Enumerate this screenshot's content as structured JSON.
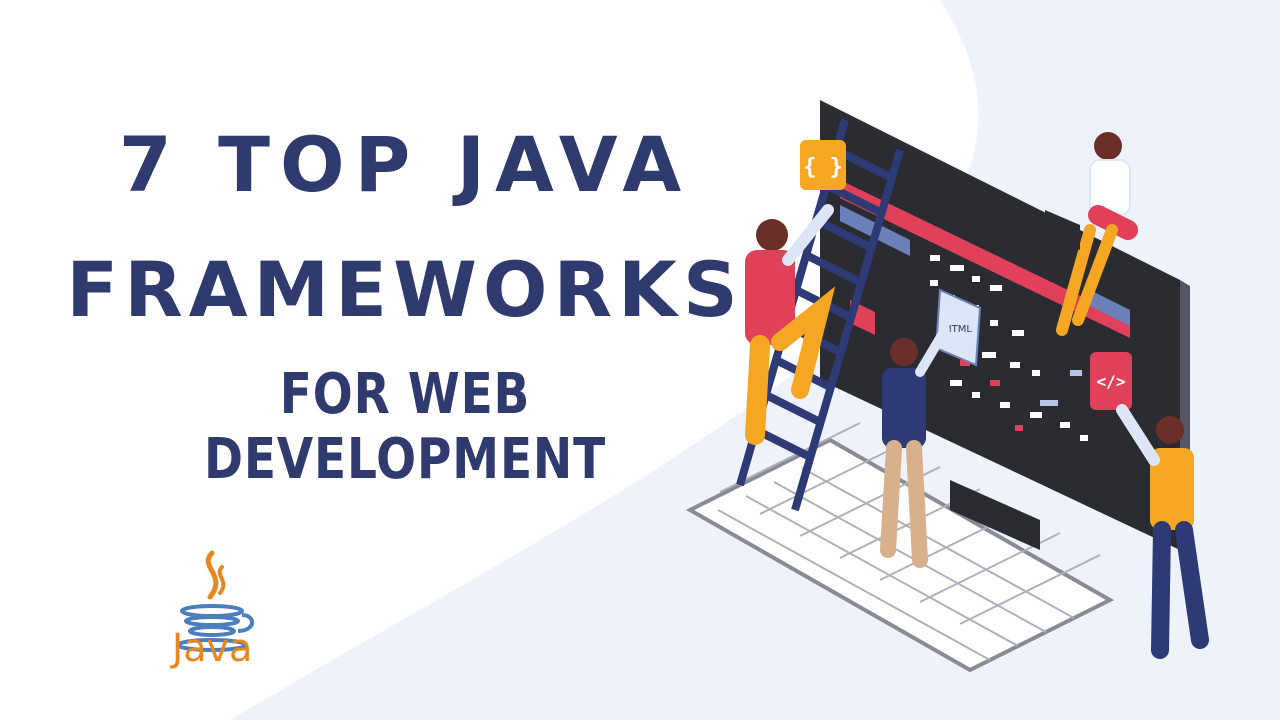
{
  "title": {
    "line1": "7 TOP JAVA",
    "line2": "FRAMEWORKS",
    "line3": "FOR  WEB DEVELOPMENT"
  },
  "logo": {
    "label": "Java",
    "icon": "java-coffee-cup-icon",
    "colors": {
      "steam": "#e8871e",
      "cup": "#4b7dbf",
      "text": "#e8871e"
    }
  },
  "illustration": {
    "icons": [
      "curly-braces-icon",
      "code-tag-icon",
      "html-document-icon"
    ],
    "badges": {
      "braces": "{ }",
      "code": "</>",
      "html": "HTML"
    }
  },
  "colors": {
    "headline": "#2f3a6e",
    "background_swoosh": "#eef3fb",
    "monitor": "#2b2b32",
    "accent_red": "#e0405a",
    "accent_orange": "#f5a623",
    "accent_navy": "#2e3a76"
  }
}
